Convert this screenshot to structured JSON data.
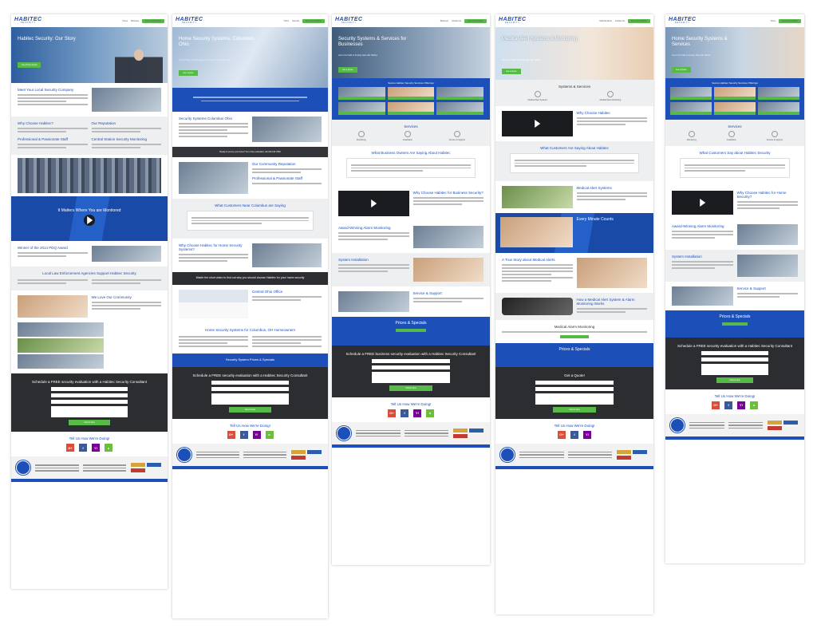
{
  "brand": {
    "logo_text": "HABITEC",
    "logo_sub": "SECURITY"
  },
  "nav": {
    "items": [
      "Home",
      "Business",
      "Security",
      "Medical Alerts",
      "Contact Us"
    ],
    "cta": "Free Consultation"
  },
  "pages": [
    {
      "hero_title": "Habitec Security: Our Story",
      "hero_button": "Get A Free Quote",
      "meet_title": "Meet Your Local Security Company",
      "why_title": "Why Choose Habitec?",
      "reputation_title": "Our Reputation",
      "staff_title": "Professional & Passionate Staff",
      "monitoring_title": "Central Station Security Monitoring",
      "band_title": "It Matters Where You are Monitored",
      "award_title": "Winner of the 2014 PDQ Award",
      "law_title": "Local Law Enforcement Agencies Support Habitec Security",
      "community_title": "We Love Our Community",
      "form_title": "Schedule a FREE security evaluation with a Habitec Security Consultant",
      "form_button": "Submit Now",
      "review_title": "Tell Us How We're Doing!"
    },
    {
      "hero_title": "Home Security Systems, Columbus, Ohio",
      "hero_sub": "The #1 Home Security System Company in Columbus, OH",
      "hero_button": "Get a Quote",
      "systems_title": "Security Systems Columbus Ohio",
      "band_text": "Ready to secure your home? For a free evaluation call 419-244-7800",
      "community_title": "Our Community Reputation",
      "staff_title": "Professional & Passionate Staff",
      "testimonial_title": "What Customers Near Columbus are Saying",
      "why_title": "Why Choose Habitec for Home Security Systems?",
      "video_title": "Watch the short video to find out why you should choose Habitec for your home security",
      "office_title": "Central Ohio Office",
      "home_title": "Home Security Systems for Columbus, OH Homeowners",
      "pricing_title": "Security System Prices & Specials",
      "form_title": "Schedule a FREE security evaluation with a Habitec Security Consultant",
      "form_button": "Submit Now",
      "review_title": "Tell Us How We're Doing!"
    },
    {
      "hero_title": "Security Systems & Services for Businesses",
      "hero_sub": "Get in the Habit of Feeling Safe with Habitec",
      "hero_button": "Get a Quote",
      "band_text": "Secure Habitec Security Services Offerings",
      "services_title": "Services",
      "services": [
        "Monitoring",
        "Installation",
        "Service & Support"
      ],
      "testimonial_title": "What Business Owners Are Saying About Habitec",
      "why_title": "Why Choose Habitec for Business Security?",
      "award_title": "Award-Winning Alarm Monitoring",
      "install_title": "System Installation",
      "support_title": "Service & Support",
      "pricing_title": "Prices & Specials",
      "form_title": "Schedule a FREE business security evaluation with a Habitec Security Consultant",
      "form_button": "Submit Now",
      "review_title": "Tell Us How We're Doing!"
    },
    {
      "hero_title": "Medical Alert Systems & Monitoring",
      "hero_sub": "Get in the Habit of Feeling Safe with Habitec",
      "hero_button": "Get a Quote",
      "systems_title": "Systems & Services",
      "services": [
        "Medical Alert Systems",
        "Medical Alert Monitoring"
      ],
      "why_title": "Why Choose Habitec",
      "testimonial_title": "What Customers Are Saying About Habitec",
      "alert_title": "Medical Alert Systems",
      "band_title": "Every Minute Counts",
      "story_title": "A True Story about Medical Alerts",
      "works_title": "How a Medical Alert System & Alarm Monitoring Works",
      "monitoring_title": "Medical Alarm Monitoring",
      "pricing_title": "Prices & Specials",
      "quote_title": "Get a Quote!",
      "form_button": "Submit Now",
      "review_title": "Tell Us How We're Doing!"
    },
    {
      "hero_title": "Home Security Systems & Services",
      "hero_sub": "Get in the Habit of Feeling Safe with Habitec",
      "hero_button": "Get a Quote",
      "band_text": "Secure Habitec Security Services Offerings",
      "services_title": "Services",
      "services": [
        "Monitoring",
        "Installation",
        "Service & Support"
      ],
      "testimonial_title": "What Customers Say about Habitec Security",
      "why_title": "Why Choose Habitec for Home Security?",
      "award_title": "Award-Winning Alarm Monitoring",
      "install_title": "System Installation",
      "support_title": "Service & Support",
      "pricing_title": "Prices & Specials",
      "form_title": "Schedule a FREE security evaluation with a Habitec Security Consultant",
      "form_button": "Submit Now",
      "review_title": "Tell Us How We're Doing!"
    }
  ],
  "review_icons": [
    "G+",
    "f",
    "Y!",
    "n"
  ],
  "colors": {
    "brand_blue": "#1d4fb8",
    "accent_green": "#57b947",
    "dark": "#333538"
  }
}
